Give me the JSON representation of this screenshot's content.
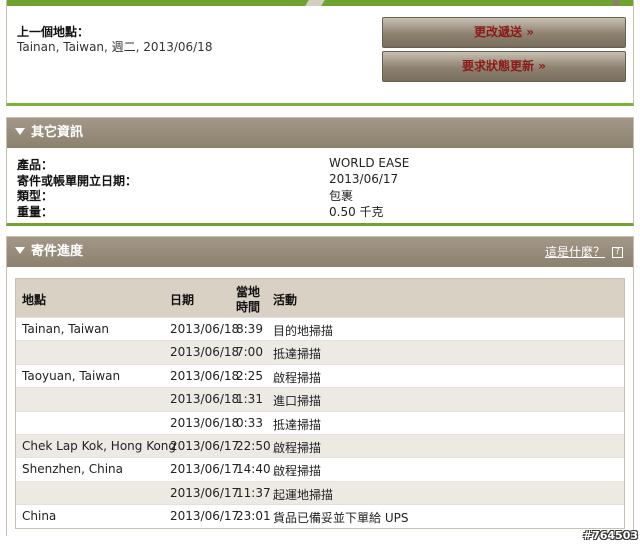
{
  "last_location": {
    "label": "上一個地點：",
    "value": "Tainan, Taiwan, 週二, 2013/06/18"
  },
  "buttons": {
    "change_delivery": "更改遞送 »",
    "request_status": "要求狀態更新 »"
  },
  "other_info": {
    "header": "其它資訊",
    "rows": [
      {
        "label": "產品：",
        "value": "WORLD EASE"
      },
      {
        "label": "寄件或帳單開立日期：",
        "value": "2013/06/17"
      },
      {
        "label": "類型：",
        "value": "包裹"
      },
      {
        "label": "重量：",
        "value": "0.50 千克"
      }
    ]
  },
  "progress": {
    "header": "寄件進度",
    "help_link": "這是什麼？",
    "columns": {
      "location": "地點",
      "date": "日期",
      "time_line1": "當地",
      "time_line2": "時間",
      "activity": "活動"
    },
    "rows": [
      {
        "location": "Tainan, Taiwan",
        "date": "2013/06/18",
        "time": "8:39",
        "activity": "目的地掃描"
      },
      {
        "location": "",
        "date": "2013/06/18",
        "time": "7:00",
        "activity": "抵達掃描"
      },
      {
        "location": "Taoyuan, Taiwan",
        "date": "2013/06/18",
        "time": "2:25",
        "activity": "啟程掃描"
      },
      {
        "location": "",
        "date": "2013/06/18",
        "time": "1:31",
        "activity": "進口掃描"
      },
      {
        "location": "",
        "date": "2013/06/18",
        "time": "0:33",
        "activity": "抵達掃描"
      },
      {
        "location": "Chek Lap Kok, Hong Kong",
        "date": "2013/06/17",
        "time": "22:50",
        "activity": "啟程掃描"
      },
      {
        "location": "Shenzhen, China",
        "date": "2013/06/17",
        "time": "14:40",
        "activity": "啟程掃描"
      },
      {
        "location": "",
        "date": "2013/06/17",
        "time": "11:37",
        "activity": "起運地掃描"
      },
      {
        "location": "China",
        "date": "2013/06/17",
        "time": "23:01",
        "activity": "貨品已備妥並下單給 UPS"
      }
    ]
  },
  "watermark": "#764503"
}
